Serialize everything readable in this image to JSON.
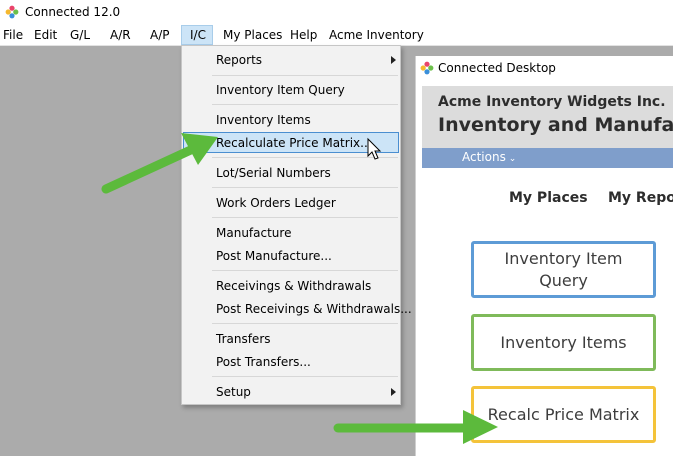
{
  "app": {
    "title": "Connected 12.0"
  },
  "menubar": {
    "items": [
      "File",
      "Edit",
      "G/L",
      "A/R",
      "A/P",
      "I/C",
      "My Places",
      "Help",
      "Acme Inventory"
    ]
  },
  "dropdown": {
    "items": {
      "reports": "Reports",
      "inventory_item_query": "Inventory Item Query",
      "inventory_items": "Inventory Items",
      "recalculate_price_matrix": "Recalculate Price Matrix...",
      "lot_serial_numbers": "Lot/Serial Numbers",
      "work_orders_ledger": "Work Orders Ledger",
      "manufacture": "Manufacture",
      "post_manufacture": "Post Manufacture...",
      "receivings_withdrawals": "Receivings & Withdrawals",
      "post_receivings_withdrawals": "Post Receivings & Withdrawals...",
      "transfers": "Transfers",
      "post_transfers": "Post Transfers...",
      "setup": "Setup"
    }
  },
  "desktop": {
    "title": "Connected Desktop",
    "company": "Acme Inventory Widgets Inc.",
    "page_title": "Inventory and Manufact",
    "actions_label": "Actions",
    "tabs": [
      "My Places",
      "My Repor"
    ],
    "tiles": {
      "query_line1": "Inventory Item",
      "query_line2": "Query",
      "items": "Inventory Items",
      "recalc": "Recalc Price Matrix"
    }
  },
  "colors": {
    "highlight": "#cce4f7",
    "arrow_green": "#5cba3c",
    "tile_blue": "#5d9bd6",
    "tile_green": "#7fba5a",
    "tile_yellow": "#f4c33a",
    "actions_bar": "#7f9ecb"
  }
}
